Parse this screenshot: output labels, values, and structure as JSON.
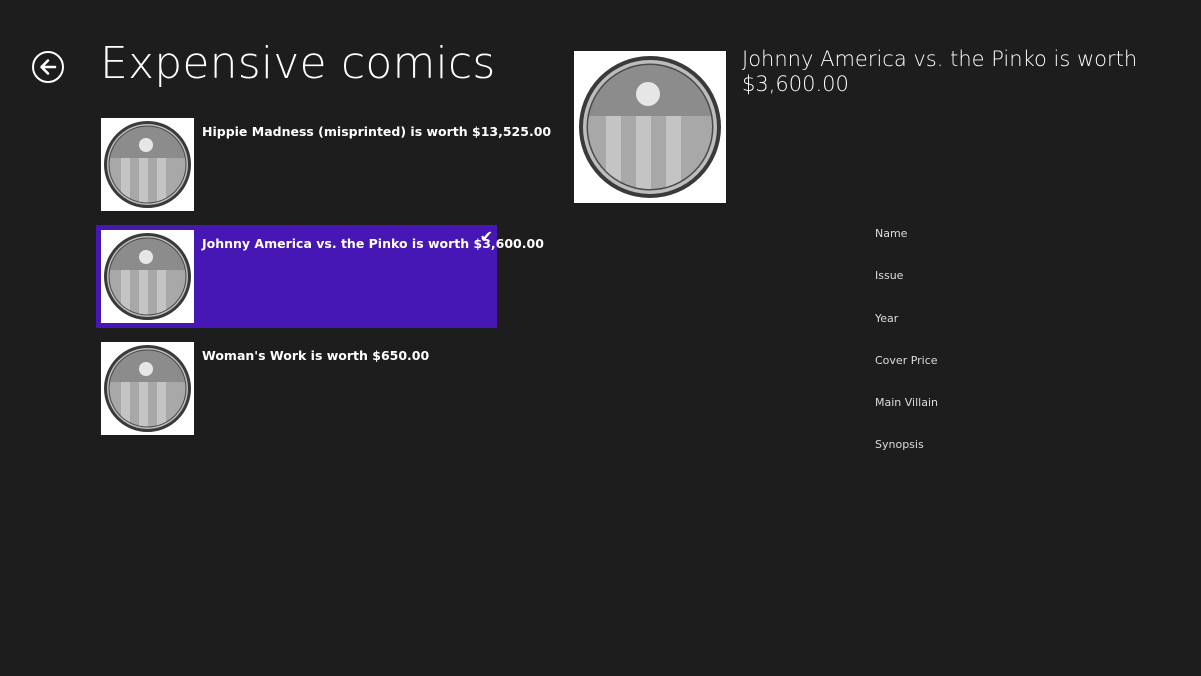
{
  "header": {
    "title": "Expensive comics"
  },
  "items": [
    {
      "label": "Hippie Madness (misprinted) is worth $13,525.00",
      "selected": false
    },
    {
      "label": "Johnny America vs. the Pinko is worth $3,600.00",
      "selected": true
    },
    {
      "label": "Woman's Work is worth $650.00",
      "selected": false
    }
  ],
  "selected_check": "✔",
  "detail": {
    "title": "Johnny America vs. the Pinko is worth $3,600.00",
    "fields": [
      "Name",
      "Issue",
      "Year",
      "Cover Price",
      "Main Villain",
      "Synopsis"
    ]
  },
  "colors": {
    "background": "#1d1d1d",
    "selection": "#4617b4"
  }
}
